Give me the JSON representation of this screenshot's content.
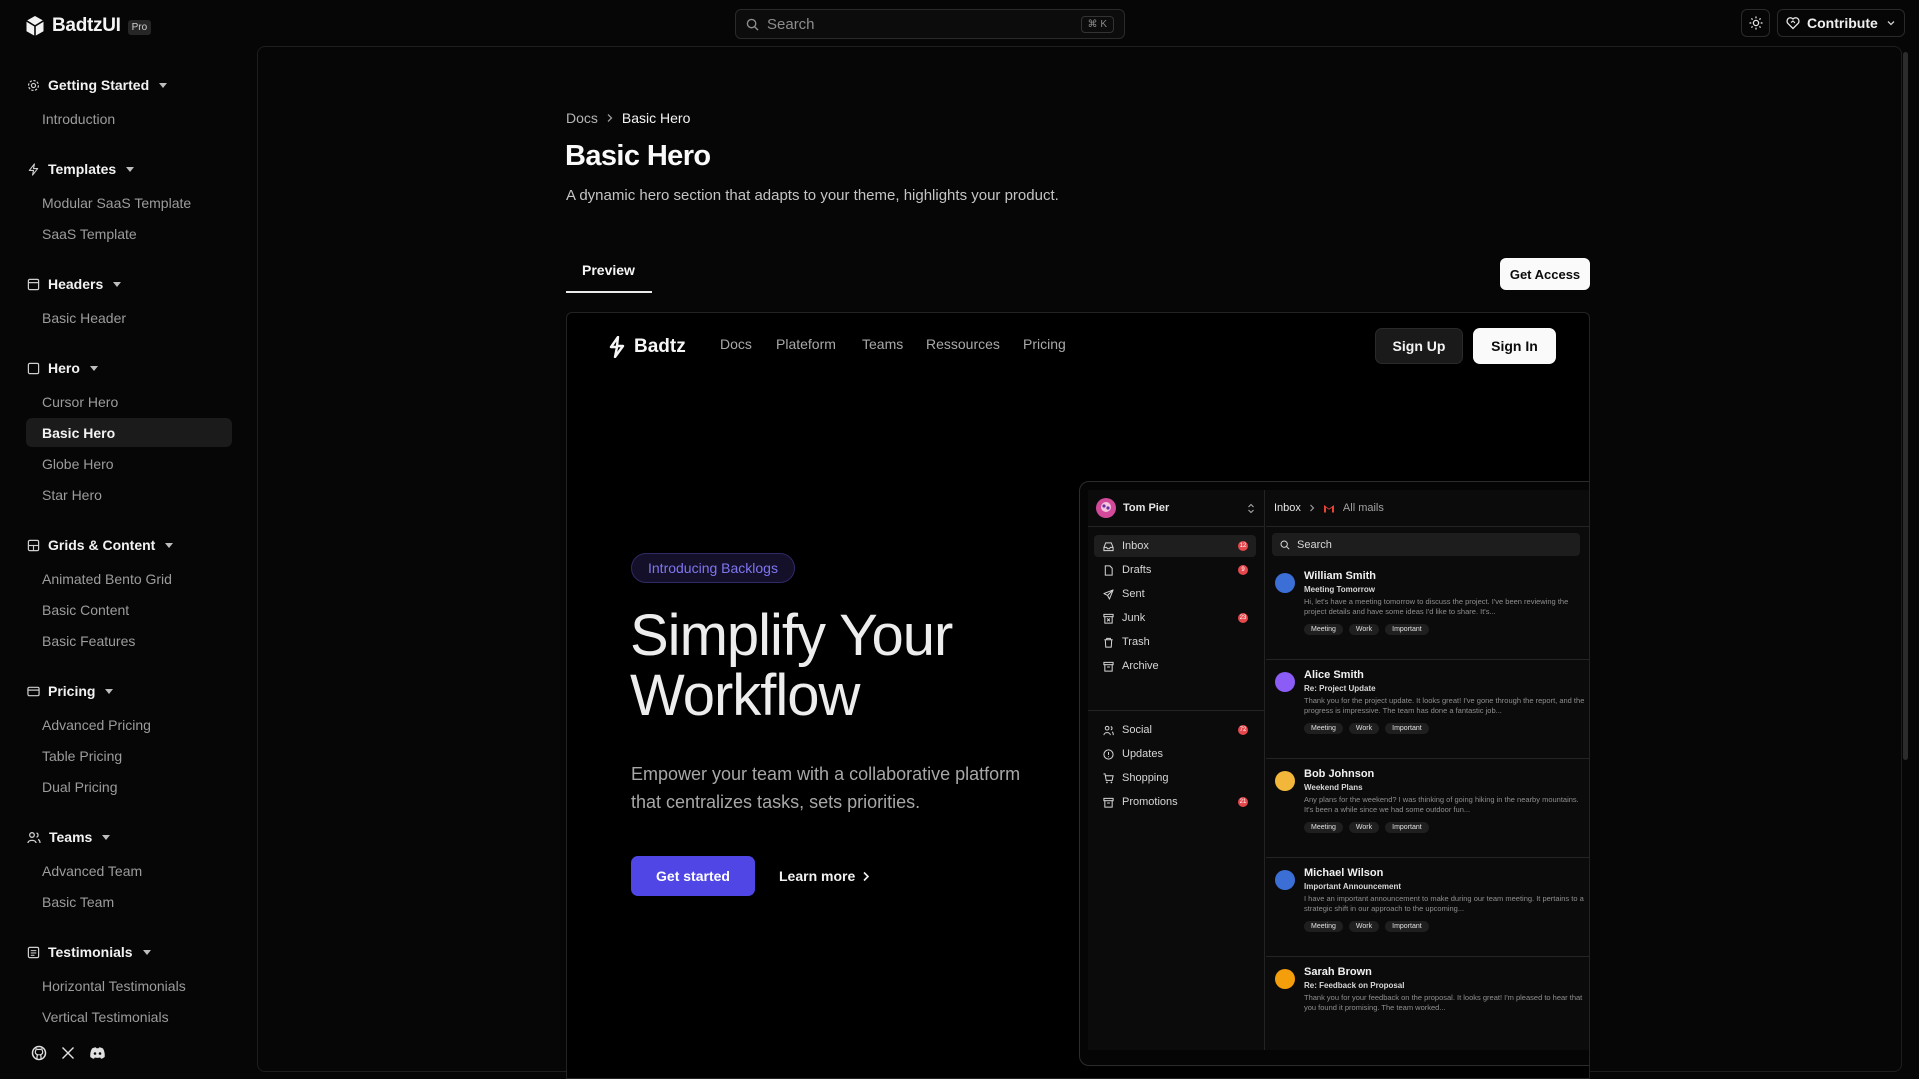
{
  "topbar": {
    "brand": "BadtzUI",
    "pro_label": "Pro",
    "search_placeholder": "Search",
    "search_shortcut": "⌘ K",
    "contribute_label": "Contribute"
  },
  "sidebar": {
    "groups": [
      {
        "title": "Getting Started",
        "items": [
          "Introduction"
        ]
      },
      {
        "title": "Templates",
        "items": [
          "Modular SaaS Template",
          "SaaS Template"
        ]
      },
      {
        "title": "Headers",
        "items": [
          "Basic Header"
        ]
      },
      {
        "title": "Hero",
        "items": [
          "Cursor Hero",
          "Basic Hero",
          "Globe Hero",
          "Star Hero"
        ]
      },
      {
        "title": "Grids & Content",
        "items": [
          "Animated Bento Grid",
          "Basic Content",
          "Basic Features"
        ]
      },
      {
        "title": "Pricing",
        "items": [
          "Advanced Pricing",
          "Table Pricing",
          "Dual Pricing"
        ]
      },
      {
        "title": "Teams",
        "items": [
          "Advanced Team",
          "Basic Team"
        ]
      },
      {
        "title": "Testimonials",
        "items": [
          "Horizontal Testimonials",
          "Vertical Testimonials"
        ]
      }
    ],
    "active_item": "Basic Hero"
  },
  "page": {
    "breadcrumb": [
      "Docs",
      "Basic Hero"
    ],
    "title": "Basic Hero",
    "description": "A dynamic hero section that adapts to your theme, highlights your product.",
    "tab": "Preview",
    "get_access_label": "Get Access"
  },
  "preview": {
    "brand": "Badtz",
    "nav": [
      "Docs",
      "Plateform",
      "Teams",
      "Ressources",
      "Pricing"
    ],
    "signup_label": "Sign Up",
    "signin_label": "Sign In",
    "badge": "Introducing Backlogs",
    "headline": "Simplify Your Workflow",
    "subtext": "Empower your team with a collaborative platform that centralizes tasks, sets priorities.",
    "cta_primary": "Get started",
    "cta_secondary": "Learn more",
    "accent_color": "#4f46e5"
  },
  "mail": {
    "account_name": "Tom Pier",
    "crumb_inbox": "Inbox",
    "crumb_all": "All mails",
    "search_placeholder": "Search",
    "folders": [
      {
        "label": "Inbox",
        "icon": "inbox-icon",
        "count": "12"
      },
      {
        "label": "Drafts",
        "icon": "file-icon",
        "count": "9"
      },
      {
        "label": "Sent",
        "icon": "send-icon",
        "count": ""
      },
      {
        "label": "Junk",
        "icon": "archive-x-icon",
        "count": "23"
      },
      {
        "label": "Trash",
        "icon": "trash-icon",
        "count": ""
      },
      {
        "label": "Archive",
        "icon": "archive-icon",
        "count": ""
      },
      {
        "label": "Social",
        "icon": "users-icon",
        "count": "72"
      },
      {
        "label": "Updates",
        "icon": "alert-circle-icon",
        "count": ""
      },
      {
        "label": "Shopping",
        "icon": "cart-icon",
        "count": ""
      },
      {
        "label": "Promotions",
        "icon": "archive-icon",
        "count": "21"
      }
    ],
    "items": [
      {
        "from": "William Smith",
        "subject": "Meeting Tomorrow",
        "preview": "Hi, let's have a meeting tomorrow to discuss the project. I've been reviewing the project details and have some ideas I'd like to share. It's...",
        "tags": [
          "Meeting",
          "Work",
          "Important"
        ],
        "avatar_color": "#3b6fd6"
      },
      {
        "from": "Alice Smith",
        "subject": "Re: Project Update",
        "preview": "Thank you for the project update. It looks great! I've gone through the report, and the progress is impressive. The team has done a fantastic job...",
        "tags": [
          "Meeting",
          "Work",
          "Important"
        ],
        "avatar_color": "#8b5cf6"
      },
      {
        "from": "Bob Johnson",
        "subject": "Weekend Plans",
        "preview": "Any plans for the weekend? I was thinking of going hiking in the nearby mountains. It's been a while since we had some outdoor fun...",
        "tags": [
          "Meeting",
          "Work",
          "Important"
        ],
        "avatar_color": "#f2b73a"
      },
      {
        "from": "Michael Wilson",
        "subject": "Important Announcement",
        "preview": "I have an important announcement to make during our team meeting. It pertains to a strategic shift in our approach to the upcoming...",
        "tags": [
          "Meeting",
          "Work",
          "Important"
        ],
        "avatar_color": "#3b6fd6"
      },
      {
        "from": "Sarah Brown",
        "subject": "Re: Feedback on Proposal",
        "preview": "Thank you for your feedback on the proposal. It looks great! I'm pleased to hear that you found it promising. The team worked...",
        "tags": [],
        "avatar_color": "#f59e0b"
      }
    ]
  }
}
